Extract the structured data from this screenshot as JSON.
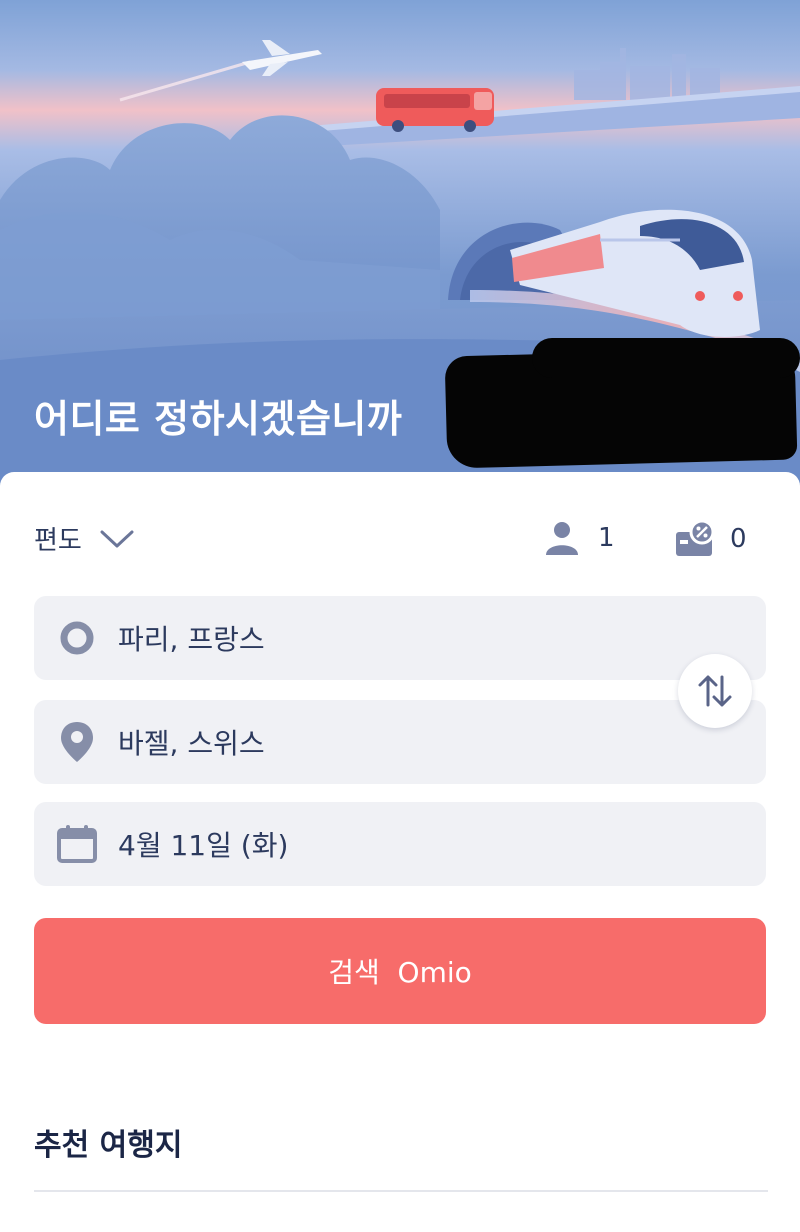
{
  "hero": {
    "title": "어디로 정하시겠습니까"
  },
  "search_form": {
    "trip_type": "편도",
    "passengers": "1",
    "discounts": "0",
    "origin": "파리, 프랑스",
    "destination": "바젤, 스위스",
    "date": "4월 11일 (화)",
    "search_label": "검색  Omio"
  },
  "sections": {
    "recommended_title": "추천 여행지"
  },
  "icons": {
    "trip_type": "chevron-down-icon",
    "passengers": "person-icon",
    "discounts": "discount-card-icon",
    "origin": "origin-circle-icon",
    "destination": "location-pin-icon",
    "date": "calendar-icon",
    "swap": "swap-arrows-icon"
  },
  "colors": {
    "accent": "#f76c6a",
    "text": "#2c3a5e",
    "field_bg": "#f0f1f5",
    "hero_blue": "#6d8fc9"
  }
}
